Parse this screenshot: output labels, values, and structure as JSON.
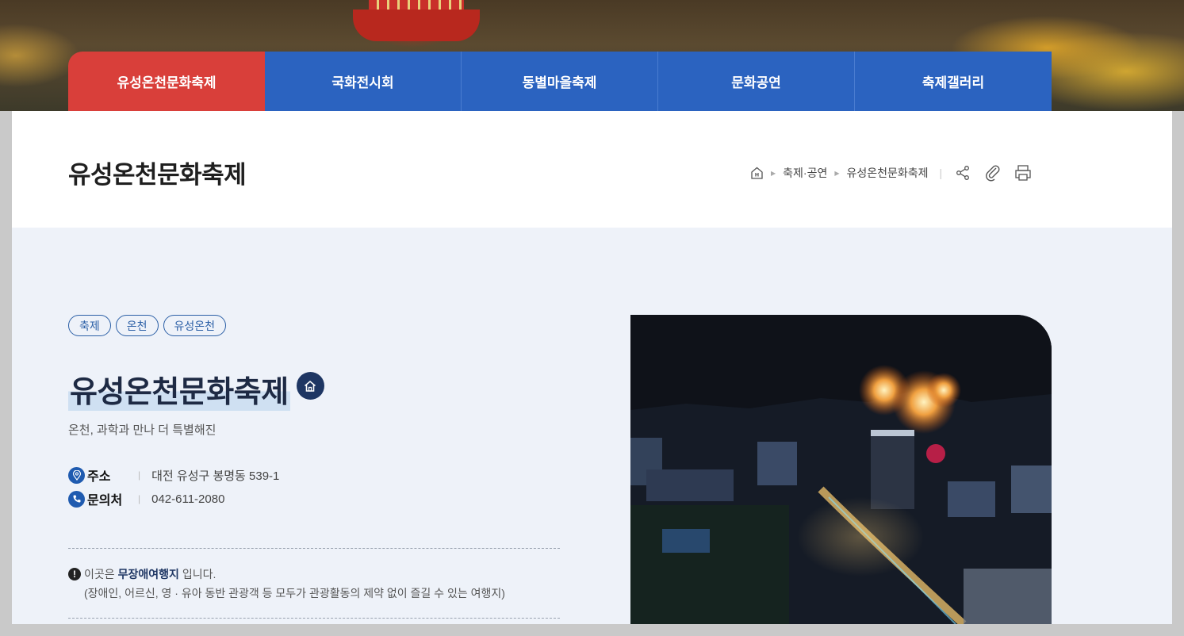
{
  "tabs": [
    {
      "label": "유성온천문화축제",
      "active": true
    },
    {
      "label": "국화전시회",
      "active": false
    },
    {
      "label": "동별마을축제",
      "active": false
    },
    {
      "label": "문화공연",
      "active": false
    },
    {
      "label": "축제갤러리",
      "active": false
    }
  ],
  "page_title": "유성온천문화축제",
  "breadcrumb": {
    "home_icon": "home-icon",
    "items": [
      "축제·공연",
      "유성온천문화축제"
    ]
  },
  "tools": [
    "share-icon",
    "attach-icon",
    "print-icon"
  ],
  "tags": [
    "축제",
    "온천",
    "유성온천"
  ],
  "main_title": "유성온천문화축제",
  "subtitle": "온천, 과학과 만나 더 특별해진",
  "info": {
    "address": {
      "label": "주소",
      "value": "대전 유성구 봉명동 539-1"
    },
    "contact": {
      "label": "문의처",
      "value": "042-611-2080"
    }
  },
  "notice": {
    "prefix": "이곳은",
    "highlight": "무장애여행지",
    "suffix": "입니다.",
    "detail": "(장애인, 어르신, 영 · 유아 동반 관광객 등 모두가 관광활동의 제약 없이 즐길 수 있는 여행지)"
  },
  "colors": {
    "tab_active": "#d93f3a",
    "tab_default": "#2b63c0",
    "content_bg": "#eef2f9",
    "navy": "#1e3663"
  }
}
